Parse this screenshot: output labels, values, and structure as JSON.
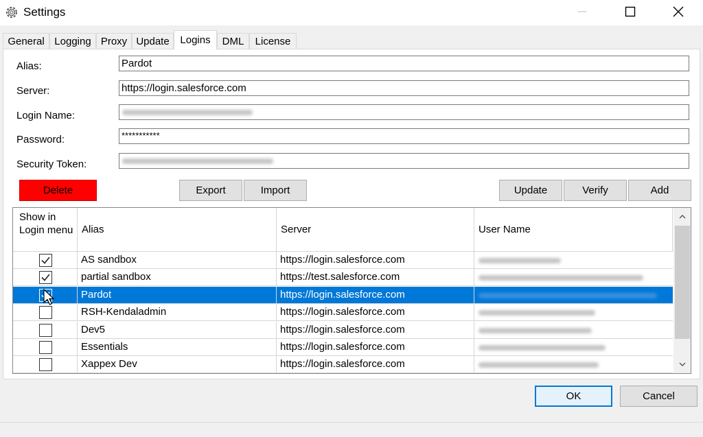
{
  "window": {
    "title": "Settings",
    "icon": "gear-icon",
    "controls": [
      "minimize-icon",
      "maximize-icon",
      "close-icon"
    ]
  },
  "tabs": [
    {
      "label": "General",
      "active": false
    },
    {
      "label": "Logging",
      "active": false
    },
    {
      "label": "Proxy",
      "active": false
    },
    {
      "label": "Update",
      "active": false
    },
    {
      "label": "Logins",
      "active": true
    },
    {
      "label": "DML",
      "active": false
    },
    {
      "label": "License",
      "active": false
    }
  ],
  "form": {
    "alias_label": "Alias:",
    "alias_value": "Pardot",
    "server_label": "Server:",
    "server_value": "https://login.salesforce.com",
    "login_label": "Login Name:",
    "password_label": "Password:",
    "password_value": "***********",
    "token_label": "Security Token:"
  },
  "buttons": {
    "delete": "Delete",
    "export": "Export",
    "import": "Import",
    "update": "Update",
    "verify": "Verify",
    "add": "Add",
    "ok": "OK",
    "cancel": "Cancel"
  },
  "colors": {
    "delete_bg": "#ff0000",
    "selection": "#0078d7"
  },
  "grid": {
    "columns": {
      "show": "Show in Login menu",
      "alias": "Alias",
      "server": "Server",
      "user": "User Name"
    },
    "rows": [
      {
        "checked": true,
        "alias": "AS sandbox",
        "server": "https://login.salesforce.com",
        "selected": false
      },
      {
        "checked": true,
        "alias": "partial sandbox",
        "server": "https://test.salesforce.com",
        "selected": false
      },
      {
        "checked": true,
        "alias": "Pardot",
        "server": "https://login.salesforce.com",
        "selected": true
      },
      {
        "checked": false,
        "alias": "RSH-Kendaladmin",
        "server": "https://login.salesforce.com",
        "selected": false
      },
      {
        "checked": false,
        "alias": "Dev5",
        "server": "https://login.salesforce.com",
        "selected": false
      },
      {
        "checked": false,
        "alias": "Essentials",
        "server": "https://login.salesforce.com",
        "selected": false
      },
      {
        "checked": false,
        "alias": "Xappex Dev",
        "server": "https://login.salesforce.com",
        "selected": false
      }
    ]
  }
}
